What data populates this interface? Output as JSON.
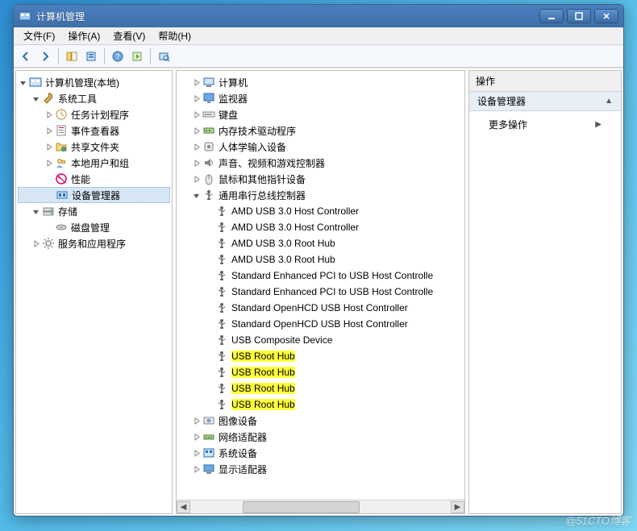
{
  "window": {
    "title": "计算机管理"
  },
  "menubar": [
    {
      "label": "文件(F)"
    },
    {
      "label": "操作(A)"
    },
    {
      "label": "查看(V)"
    },
    {
      "label": "帮助(H)"
    }
  ],
  "left_tree": {
    "root": {
      "label": "计算机管理(本地)"
    },
    "system_tools": {
      "label": "系统工具"
    },
    "st_children": [
      {
        "label": "任务计划程序",
        "icon": "clock"
      },
      {
        "label": "事件查看器",
        "icon": "event"
      },
      {
        "label": "共享文件夹",
        "icon": "folder-share"
      },
      {
        "label": "本地用户和组",
        "icon": "users"
      },
      {
        "label": "性能",
        "icon": "perf"
      },
      {
        "label": "设备管理器",
        "icon": "device",
        "selected": true
      }
    ],
    "storage": {
      "label": "存储"
    },
    "storage_children": [
      {
        "label": "磁盘管理",
        "icon": "disk"
      }
    ],
    "services": {
      "label": "服务和应用程序"
    }
  },
  "mid_tree": {
    "top": [
      {
        "label": "计算机",
        "icon": "computer"
      },
      {
        "label": "监视器",
        "icon": "monitor"
      },
      {
        "label": "键盘",
        "icon": "keyboard"
      },
      {
        "label": "内存技术驱动程序",
        "icon": "memory"
      },
      {
        "label": "人体学输入设备",
        "icon": "hid"
      },
      {
        "label": "声音、视频和游戏控制器",
        "icon": "sound"
      },
      {
        "label": "鼠标和其他指针设备",
        "icon": "mouse"
      }
    ],
    "usb_controller": {
      "label": "通用串行总线控制器"
    },
    "usb_children": [
      {
        "label": "AMD USB 3.0 Host Controller"
      },
      {
        "label": "AMD USB 3.0 Host Controller"
      },
      {
        "label": "AMD USB 3.0 Root Hub"
      },
      {
        "label": "AMD USB 3.0 Root Hub"
      },
      {
        "label": "Standard Enhanced PCI to USB Host Controlle"
      },
      {
        "label": "Standard Enhanced PCI to USB Host Controlle"
      },
      {
        "label": "Standard OpenHCD USB Host Controller"
      },
      {
        "label": "Standard OpenHCD USB Host Controller"
      },
      {
        "label": "USB Composite Device"
      },
      {
        "label": "USB Root Hub",
        "highlight": true
      },
      {
        "label": "USB Root Hub",
        "highlight": true
      },
      {
        "label": "USB Root Hub",
        "highlight": true
      },
      {
        "label": "USB Root Hub",
        "highlight": true
      }
    ],
    "bottom": [
      {
        "label": "图像设备",
        "icon": "imaging"
      },
      {
        "label": "网络适配器",
        "icon": "network"
      },
      {
        "label": "系统设备",
        "icon": "system"
      },
      {
        "label": "显示适配器",
        "icon": "display"
      }
    ]
  },
  "right_panel": {
    "header": "操作",
    "section": "设备管理器",
    "more_actions": "更多操作"
  },
  "watermark": "@51CTO博客"
}
